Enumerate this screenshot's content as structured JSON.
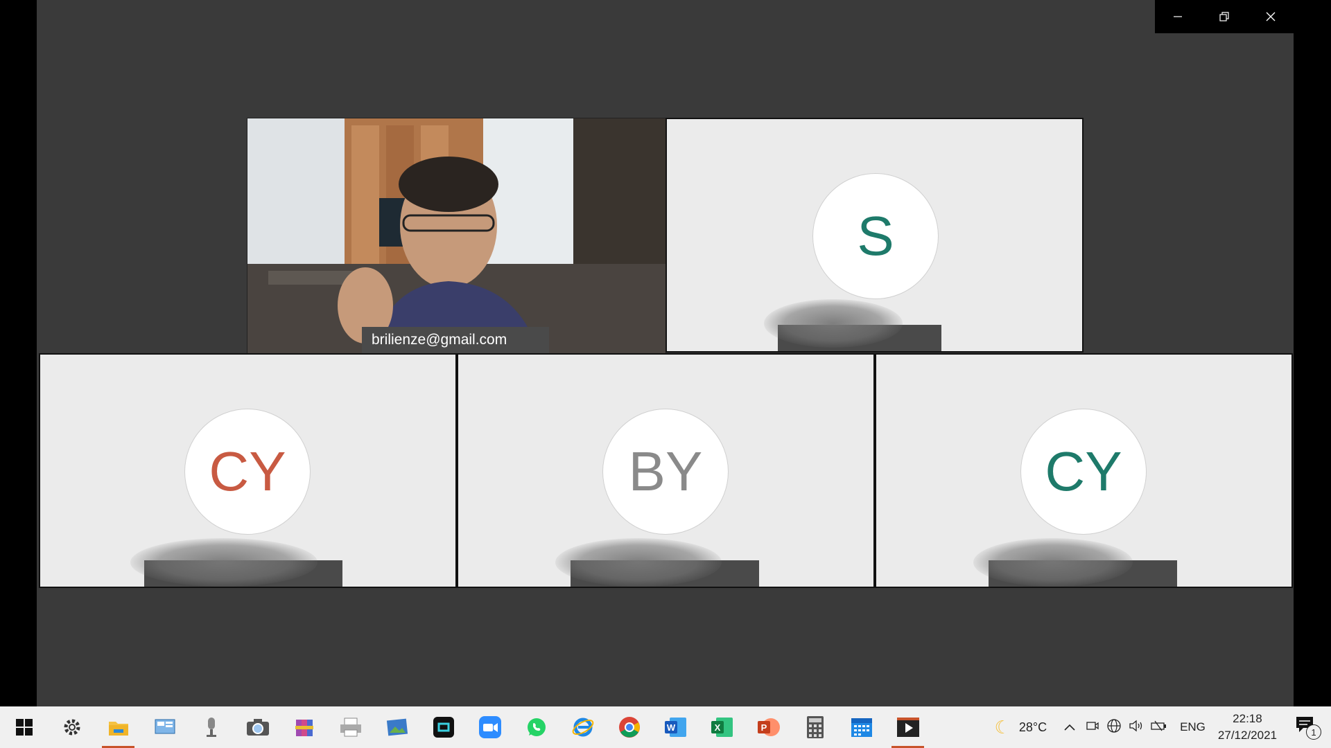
{
  "window": {
    "controls": [
      "minimize",
      "restore",
      "close"
    ]
  },
  "participants": [
    {
      "name": "brilienze@gmail.com",
      "video": true
    },
    {
      "initials": "S",
      "color": "#1e7a6a"
    },
    {
      "initials": "CY",
      "color": "#c85a42"
    },
    {
      "initials": "BY",
      "color": "#8a8a8a"
    },
    {
      "initials": "CY",
      "color": "#1e7a6a"
    }
  ],
  "taskbar": {
    "apps": [
      "start-icon",
      "settings-icon",
      "file-explorer-icon",
      "control-panel-icon",
      "microphone-icon",
      "camera-icon",
      "winrar-icon",
      "printer-icon",
      "photos-icon",
      "capcut-icon",
      "zoom-icon",
      "whatsapp-icon",
      "ie-icon",
      "chrome-icon",
      "word-icon",
      "excel-icon",
      "powerpoint-icon",
      "calculator-icon",
      "calendar-icon",
      "media-player-icon"
    ],
    "weather": "28°C",
    "language": "ENG",
    "time": "22:18",
    "date": "27/12/2021",
    "notification_count": "1"
  }
}
